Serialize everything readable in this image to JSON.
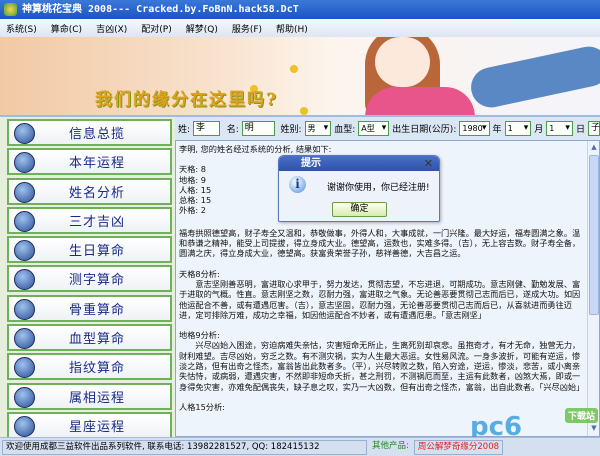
{
  "window": {
    "title": "神算桃花宝典 2008--- Cracked.by.FoBnN.hack58.DcT"
  },
  "menu": [
    "系统(S)",
    "算命(C)",
    "吉凶(X)",
    "配对(P)",
    "解梦(Q)",
    "服务(F)",
    "帮助(H)"
  ],
  "banner": {
    "slogan": "我们的缘分在这里吗?"
  },
  "sidebar": {
    "items": [
      "信息总揽",
      "本年运程",
      "姓名分析",
      "三才吉凶",
      "生日算命",
      "测字算命",
      "骨重算命",
      "血型算命",
      "指纹算命",
      "属相运程",
      "星座运程"
    ]
  },
  "form": {
    "surname_label": "姓:",
    "surname": "李",
    "name_label": "名:",
    "name": "明",
    "gender_label": "姓别:",
    "gender": "男",
    "blood_label": "血型:",
    "blood": "A型",
    "birth_label": "出生日期(公历):",
    "year": "1980",
    "year_unit": "年",
    "month": "1",
    "month_unit": "月",
    "day": "1",
    "day_unit": "日",
    "extra": "子"
  },
  "result": {
    "intro": "李明, 您的姓名经过系统的分析, 结果如下:",
    "grids": "天格: 8\n地格: 9\n人格: 15\n总格: 15\n外格: 2",
    "p1": "福寿拱照德望高，财子寿全又温和，恭敬做事，外得人和，大事成就，一门兴隆。最大好运，福寿圆满之象。温和恭谦之精神，能受上司提拔，得立身成大业。德望高，运数也，实难多得。（吉），无上容吉数。财子寿全备，圆满之庆，得立身成大业，德望高。获富贵荣誉子孙，慈祥善德，大吉昌之运。",
    "p2_title": "天格8分析:",
    "p2": "　　意志坚刚善恶明，富进取心求甲于，努力发达，贯彻志望，不忘进退，可期成功。意志刚健、勤勉发展、富于进取的气概。性直。意志刚坚之数，忍耐力强，富进取之气象。无论善恶要贯彻己志而后已，遂成大功。如因他运配合不善，或有遭遇厄害。（吉），意志坚固，忍耐力强，无论善恶要贯彻己志而后已，从喜就进而勇往迈进，定可排除万难，成功之幸福，如因他运配合不妙者，或有遭遇厄患。「意志刚坚」",
    "p3_title": "地格9分析:",
    "p3": "　　兴尽凶始入困途，穷迫病难失亲怙，灾害短命无所止，生离死别却哀悲。虽抱奇才，有才无命，独营无力，财利难望。吉尽凶始，穷乏之数。有不测灾祸，实为人生最大恶运。女性易风流。一身多波折，可能有逆运，惨淡之路，但有出奇之怪杰，富翁皆出此数者多。（平），兴尽转败之数，陷入穷途，逆运，惨淡，悲苦，或小离亲失怙恃，或病弱，遭遇灾害，不然即非短命夭折，甚之刑罚，不测祸厄而至，主运有此数者，凶煞大焉，即或一身得免灾害，亦难免配偶丧失，缺子息之叹，实乃一大凶数，但有出奇之怪杰，富翁，出自此数者。「兴尽凶始」",
    "p4_title": "人格15分析:"
  },
  "dialog": {
    "title": "提示",
    "message": "谢谢你使用，你已经注册!",
    "ok": "确定"
  },
  "status": {
    "welcome": "欢迎使用成都三益软件出品系列软件, 联系电话: 13982281527, QQ: 182415132",
    "other_label": "其他产品:",
    "other_product": "周公解梦奇缘分2008"
  },
  "watermark": {
    "logo": "pc6.com",
    "tag": "下载站"
  }
}
